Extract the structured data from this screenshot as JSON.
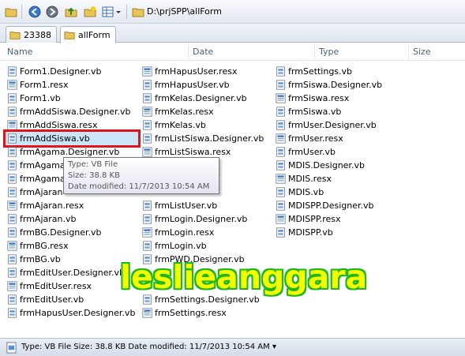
{
  "address": {
    "path": "D:\\prjSPP\\allForm"
  },
  "tabs": [
    {
      "label": "23388"
    },
    {
      "label": "allForm"
    }
  ],
  "columns": {
    "name": "Name",
    "date": "Date",
    "type": "Type",
    "size": "Size"
  },
  "files": {
    "col1": [
      "Form1.Designer.vb",
      "Form1.resx",
      "Form1.vb",
      "frmAddSiswa.Designer.vb",
      "frmAddSiswa.resx",
      "frmAddSiswa.vb",
      "frmAgama.Designer.vb",
      "frmAgama",
      "frmAgama",
      "frmAjaran",
      "frmAjaran.resx",
      "frmAjaran.vb",
      "frmBG.Designer.vb",
      "frmBG.resx",
      "frmBG.vb",
      "frmEditUser.Designer.vb",
      "frmEditUser.resx",
      "frmEditUser.vb",
      "frmHapusUser.Designer.vb"
    ],
    "col2": [
      "frmHapusUser.resx",
      "frmHapusUser.vb",
      "frmKelas.Designer.vb",
      "frmKelas.resx",
      "frmKelas.vb",
      "frmListSiswa.Designer.vb",
      "frmListSiswa.resx",
      "",
      "gner.vb",
      "",
      "frmListUser.vb",
      "frmLogin.Designer.vb",
      "frmLogin.resx",
      "frmLogin.vb",
      "frmPWD.Designer.vb",
      "",
      "",
      "frmSettings.Designer.vb",
      "frmSettings.resx"
    ],
    "col3": [
      "frmSettings.vb",
      "frmSiswa.Designer.vb",
      "frmSiswa.resx",
      "frmSiswa.vb",
      "frmUser.Designer.vb",
      "frmUser.resx",
      "frmUser.vb",
      "MDIS.Designer.vb",
      "MDIS.resx",
      "MDIS.vb",
      "MDISPP.Designer.vb",
      "MDISPP.resx",
      "MDISPP.vb"
    ]
  },
  "tooltip": {
    "type": "Type: VB File",
    "size": "Size: 38.8 KB",
    "date": "Date modified: 11/7/2013 10:54 AM"
  },
  "watermark": "leslieanggara",
  "status": {
    "text": "Type: VB File Size: 38.8 KB Date modified: 11/7/2013 10:54 AM"
  },
  "colors": {
    "highlight": "#e0151b",
    "watermark_fill": "#f3ff00",
    "watermark_outline": "#1db61c"
  },
  "icons": [
    "back-icon",
    "forward-icon",
    "up-folder-icon",
    "new-folder-icon",
    "view-options-icon",
    "folder-icon",
    "vb-file-icon",
    "resx-file-icon"
  ]
}
